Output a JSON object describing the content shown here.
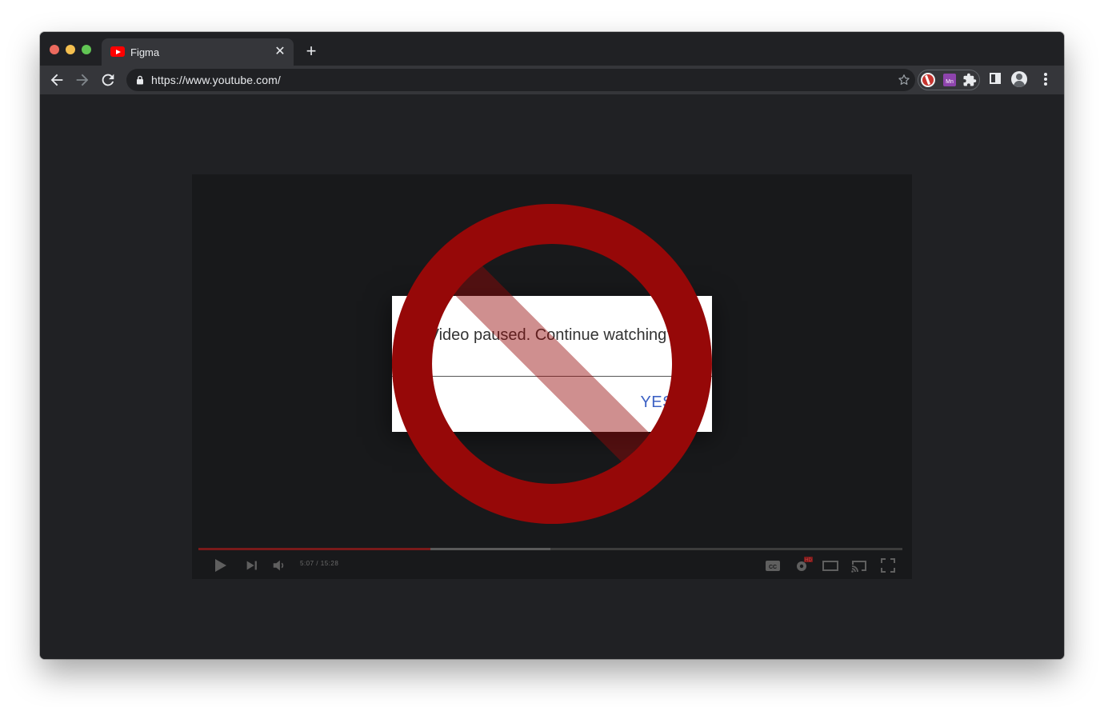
{
  "browser": {
    "tab": {
      "title": "Figma",
      "favicon": "youtube-icon"
    },
    "new_tab_icon": "plus-icon",
    "url": "https://www.youtube.com/",
    "extensions": [
      "no-icon",
      "mn-icon",
      "puzzle-icon"
    ],
    "ext_mn_label": "Mn"
  },
  "dialog": {
    "message": "Video paused. Continue watching?",
    "confirm_label": "YES"
  },
  "overlay": {
    "icon": "prohibited-icon",
    "color": "#960808"
  },
  "player": {
    "current_time": "5:07",
    "duration": "15:28",
    "time_separator": " / ",
    "progress_played_fraction": 0.33,
    "progress_buffered_fraction": 0.5,
    "progress_color": "#7a1a1a",
    "hd_badge": "HD",
    "controls": [
      "play-icon",
      "next-icon",
      "volume-icon",
      "captions-icon",
      "settings-icon",
      "theater-mode-icon",
      "cast-icon",
      "fullscreen-icon"
    ]
  },
  "colors": {
    "browser_bg": "#202124",
    "toolbar_bg": "#35363a",
    "accent_link": "#3d62c4"
  }
}
